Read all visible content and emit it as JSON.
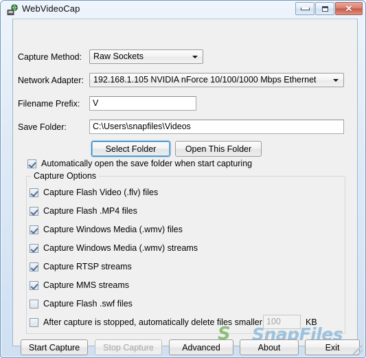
{
  "window": {
    "title": "WebVideoCap",
    "icon": "webcam-globe-icon",
    "controls": {
      "minimize": "minimize-button",
      "maximize": "maximize-button",
      "close": "close-button",
      "close_glyph": "✕"
    },
    "frame_color": "#cfe0f2",
    "client_background": "#f0f0f0"
  },
  "form": {
    "capture_method": {
      "label": "Capture Method:",
      "value": "Raw Sockets"
    },
    "network_adapter": {
      "label": "Network Adapter:",
      "value": "192.168.1.105   NVIDIA nForce 10/100/1000 Mbps Ethernet"
    },
    "filename_prefix": {
      "label": "Filename Prefix:",
      "value": "V"
    },
    "save_folder": {
      "label": "Save Folder:",
      "value": "C:\\Users\\snapfiles\\Videos"
    },
    "select_folder_button": "Select Folder",
    "open_folder_button": "Open This Folder",
    "auto_open": {
      "label": "Automatically open the save folder when start capturing",
      "checked": true
    }
  },
  "capture_options": {
    "title": "Capture Options",
    "items": [
      {
        "label": "Capture Flash Video (.flv) files",
        "checked": true
      },
      {
        "label": "Capture Flash .MP4 files",
        "checked": true
      },
      {
        "label": "Capture Windows Media (.wmv) files",
        "checked": true
      },
      {
        "label": "Capture Windows Media (.wmv) streams",
        "checked": true
      },
      {
        "label": "Capture RTSP streams",
        "checked": true
      },
      {
        "label": "Capture MMS streams",
        "checked": true
      },
      {
        "label": "Capture Flash .swf files",
        "checked": false
      }
    ],
    "delete_small": {
      "label": "After capture is stopped, automatically delete files smaller than:",
      "checked": false,
      "size_value": "100",
      "units": "KB"
    }
  },
  "footer": {
    "buttons": [
      {
        "label": "Start Capture",
        "enabled": true
      },
      {
        "label": "Stop Capture",
        "enabled": false
      },
      {
        "label": "Advanced",
        "enabled": true
      },
      {
        "label": "About",
        "enabled": true
      },
      {
        "label": "Exit",
        "enabled": true
      }
    ]
  },
  "watermark": {
    "logo": "S",
    "text": "SnapFiles",
    "logo_color": "#8dbf7a",
    "text_color": "#9cc2de"
  }
}
